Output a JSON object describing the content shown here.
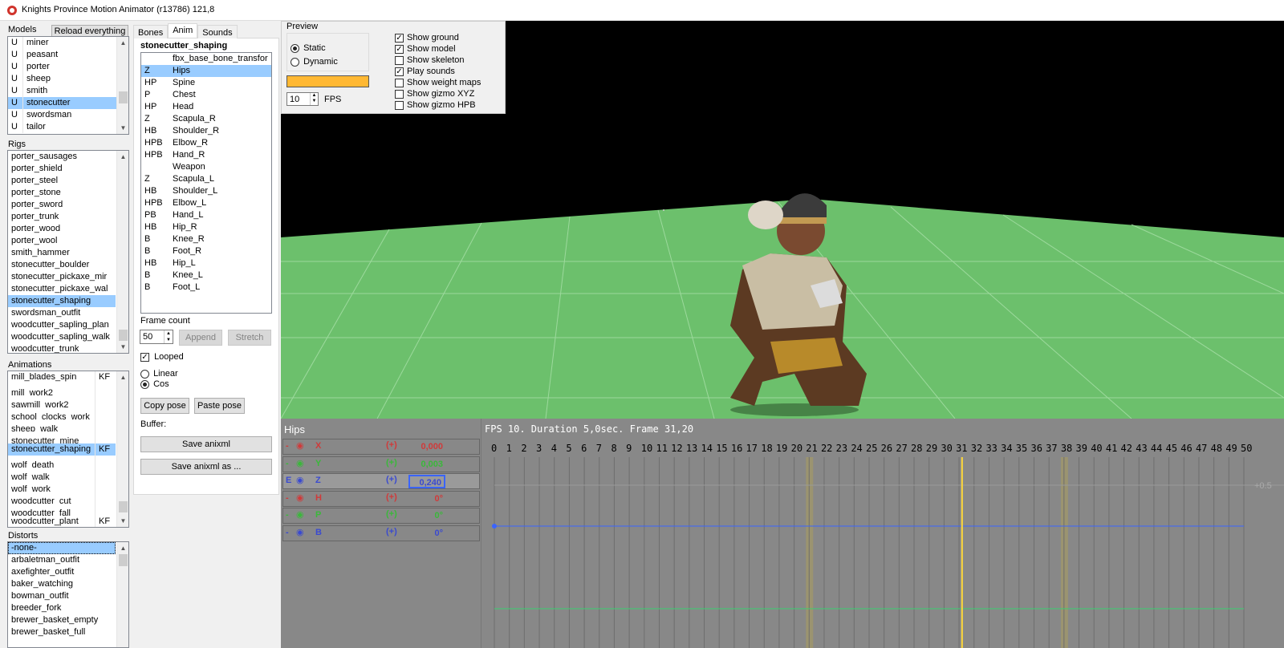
{
  "window": {
    "title": "Knights Province Motion Animator (r13786) 121,8"
  },
  "models": {
    "label": "Models",
    "reload_label": "Reload everything",
    "items": [
      {
        "flag": "U",
        "name": "miner"
      },
      {
        "flag": "U",
        "name": "peasant"
      },
      {
        "flag": "U",
        "name": "porter"
      },
      {
        "flag": "U",
        "name": "sheep"
      },
      {
        "flag": "U",
        "name": "smith"
      },
      {
        "flag": "U",
        "name": "stonecutter"
      },
      {
        "flag": "U",
        "name": "swordsman"
      },
      {
        "flag": "U",
        "name": "tailor"
      }
    ]
  },
  "rigs": {
    "label": "Rigs",
    "items": [
      "porter_sausages",
      "porter_shield",
      "porter_steel",
      "porter_stone",
      "porter_sword",
      "porter_trunk",
      "porter_wood",
      "porter_wool",
      "smith_hammer",
      "stonecutter_boulder",
      "stonecutter_pickaxe_mir",
      "stonecutter_pickaxe_wal",
      "stonecutter_shaping",
      "swordsman_outfit",
      "woodcutter_sapling_plan",
      "woodcutter_sapling_walk",
      "woodcutter_trunk"
    ]
  },
  "animations": {
    "label": "Animations",
    "items": [
      {
        "name": "mill_blades_spin",
        "kf": "KF"
      },
      {
        "name": "mill_work2",
        "kf": ""
      },
      {
        "name": "sawmill_work2",
        "kf": ""
      },
      {
        "name": "school_clocks_work",
        "kf": ""
      },
      {
        "name": "sheep_walk",
        "kf": ""
      },
      {
        "name": "stonecutter_mine",
        "kf": ""
      },
      {
        "name": "stonecutter_shaping",
        "kf": "KF"
      },
      {
        "name": "wolf_death",
        "kf": ""
      },
      {
        "name": "wolf_walk",
        "kf": ""
      },
      {
        "name": "wolf_work",
        "kf": ""
      },
      {
        "name": "woodcutter_cut",
        "kf": ""
      },
      {
        "name": "woodcutter_fall",
        "kf": ""
      },
      {
        "name": "woodcutter_plant",
        "kf": "KF"
      }
    ]
  },
  "distorts": {
    "label": "Distorts",
    "items": [
      "-none-",
      "arbaletman_outfit",
      "axefighter_outfit",
      "baker_watching",
      "bowman_outfit",
      "breeder_fork",
      "brewer_basket_empty",
      "brewer_basket_full"
    ]
  },
  "tabs": [
    "Bones",
    "Anim",
    "Sounds"
  ],
  "anim": {
    "name": "stonecutter_shaping",
    "bones": [
      {
        "flag": "",
        "name": "fbx_base_bone_transfor"
      },
      {
        "flag": "Z",
        "name": "Hips"
      },
      {
        "flag": "HP",
        "name": "Spine"
      },
      {
        "flag": "P",
        "name": "Chest"
      },
      {
        "flag": "HP",
        "name": "Head"
      },
      {
        "flag": "Z",
        "name": "Scapula_R"
      },
      {
        "flag": "HB",
        "name": "Shoulder_R"
      },
      {
        "flag": "HPB",
        "name": "Elbow_R"
      },
      {
        "flag": "HPB",
        "name": "Hand_R"
      },
      {
        "flag": "",
        "name": "Weapon"
      },
      {
        "flag": "Z",
        "name": "Scapula_L"
      },
      {
        "flag": "HB",
        "name": "Shoulder_L"
      },
      {
        "flag": "HPB",
        "name": "Elbow_L"
      },
      {
        "flag": "PB",
        "name": "Hand_L"
      },
      {
        "flag": "HB",
        "name": "Hip_R"
      },
      {
        "flag": "B",
        "name": "Knee_R"
      },
      {
        "flag": "B",
        "name": "Foot_R"
      },
      {
        "flag": "HB",
        "name": "Hip_L"
      },
      {
        "flag": "B",
        "name": "Knee_L"
      },
      {
        "flag": "B",
        "name": "Foot_L"
      }
    ],
    "frame_count_label": "Frame count",
    "frame_count": "50",
    "append_label": "Append",
    "stretch_label": "Stretch",
    "looped_label": "Looped",
    "linear_label": "Linear",
    "cos_label": "Cos",
    "copy_pose_label": "Copy pose",
    "paste_pose_label": "Paste pose",
    "buffer_label": "Buffer:",
    "save_label": "Save anixml",
    "save_as_label": "Save anixml as ..."
  },
  "preview": {
    "label": "Preview",
    "static_label": "Static",
    "dynamic_label": "Dynamic",
    "fps_value": "10",
    "fps_label": "FPS",
    "swatch_color": "#ffb833",
    "options": [
      {
        "label": "Show ground",
        "checked": true
      },
      {
        "label": "Show model",
        "checked": true
      },
      {
        "label": "Show skeleton",
        "checked": false
      },
      {
        "label": "Play sounds",
        "checked": true
      },
      {
        "label": "Show weight maps",
        "checked": false
      },
      {
        "label": "Show gizmo XYZ",
        "checked": false
      },
      {
        "label": "Show gizmo HPB",
        "checked": false
      }
    ]
  },
  "timeline": {
    "bone_label": "Hips",
    "status": "FPS 10. Duration 5,0sec. Frame 31,20",
    "channels": [
      {
        "prefix": "-",
        "axis": "X",
        "value": "0,000",
        "color": "#d03a3a"
      },
      {
        "prefix": "-",
        "axis": "Y",
        "value": "0,003",
        "color": "#3ab83a"
      },
      {
        "prefix": "E",
        "axis": "Z",
        "value": "0,240",
        "color": "#3a4ad0"
      },
      {
        "prefix": "-",
        "axis": "H",
        "value": "0°",
        "color": "#d03a3a"
      },
      {
        "prefix": "-",
        "axis": "P",
        "value": "0°",
        "color": "#3ab83a"
      },
      {
        "prefix": "-",
        "axis": "B",
        "value": "0°",
        "color": "#3a4ad0"
      }
    ],
    "frame_ticks": [
      "0",
      "1",
      "2",
      "3",
      "4",
      "5",
      "6",
      "7",
      "8",
      "9",
      "10",
      "11",
      "12",
      "13",
      "14",
      "15",
      "16",
      "17",
      "18",
      "19",
      "20",
      "21",
      "22",
      "23",
      "24",
      "25",
      "26",
      "27",
      "28",
      "29",
      "30",
      "31",
      "32",
      "33",
      "34",
      "35",
      "36",
      "37",
      "38",
      "39",
      "40",
      "41",
      "42",
      "43",
      "44",
      "45",
      "46",
      "47",
      "48",
      "49",
      "50"
    ],
    "current_frame": 31.2,
    "keyframes": [
      21,
      38
    ],
    "scale_label": "+0.5"
  }
}
